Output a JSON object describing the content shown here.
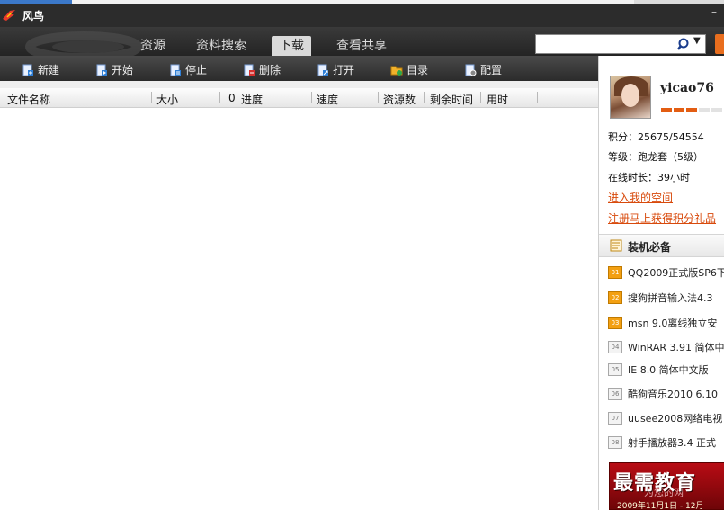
{
  "app": {
    "title": "风鸟",
    "minimize_label": "–"
  },
  "nav": {
    "tabs": [
      {
        "label": "资源"
      },
      {
        "label": "资料搜索"
      },
      {
        "label": "下载"
      },
      {
        "label": "查看共享"
      }
    ],
    "active_tab": "下载",
    "search": {
      "value": "",
      "placeholder": ""
    }
  },
  "toolbar": {
    "buttons": [
      {
        "label": "新建",
        "icon": "new-icon"
      },
      {
        "label": "开始",
        "icon": "start-icon"
      },
      {
        "label": "停止",
        "icon": "stop-icon"
      },
      {
        "label": "删除",
        "icon": "delete-icon"
      },
      {
        "label": "打开",
        "icon": "open-icon"
      },
      {
        "label": "目录",
        "icon": "folder-icon"
      },
      {
        "label": "配置",
        "icon": "settings-icon"
      }
    ]
  },
  "table": {
    "columns": [
      "文件名称",
      "大小",
      "进度",
      "速度",
      "资源数",
      "剩余时间",
      "用时"
    ],
    "progress_glyph": "0",
    "rows": []
  },
  "profile": {
    "username": "yicao76",
    "level_bar_filled": 3,
    "level_bar_total": 5,
    "points": "积分：25675/54554",
    "grade": "等级：跑龙套（5级）",
    "online_time": "在线时长：39小时",
    "space_link": "进入我的空间",
    "register_link": "注册马上获得积分礼品"
  },
  "essentials": {
    "title": "装机必备",
    "items": [
      {
        "rank": "01",
        "label": "QQ2009正式版SP6下"
      },
      {
        "rank": "02",
        "label": "搜狗拼音输入法4.3"
      },
      {
        "rank": "03",
        "label": "msn 9.0离线独立安"
      },
      {
        "rank": "04",
        "label": "WinRAR 3.91 简体中"
      },
      {
        "rank": "05",
        "label": "IE 8.0 简体中文版"
      },
      {
        "rank": "06",
        "label": "酷狗音乐2010 6.10"
      },
      {
        "rank": "07",
        "label": "uusee2008网络电视"
      },
      {
        "rank": "08",
        "label": "射手播放器3.4 正式"
      }
    ]
  },
  "banner": {
    "headline": "最需教育",
    "subtitle": "为您的网",
    "date": "2009年11月1日 - 12月"
  },
  "colors": {
    "accent": "#e35d12",
    "link": "#d84a0c",
    "toolbar_bg": "#2b2b2b",
    "nav_bg": "#242424"
  }
}
